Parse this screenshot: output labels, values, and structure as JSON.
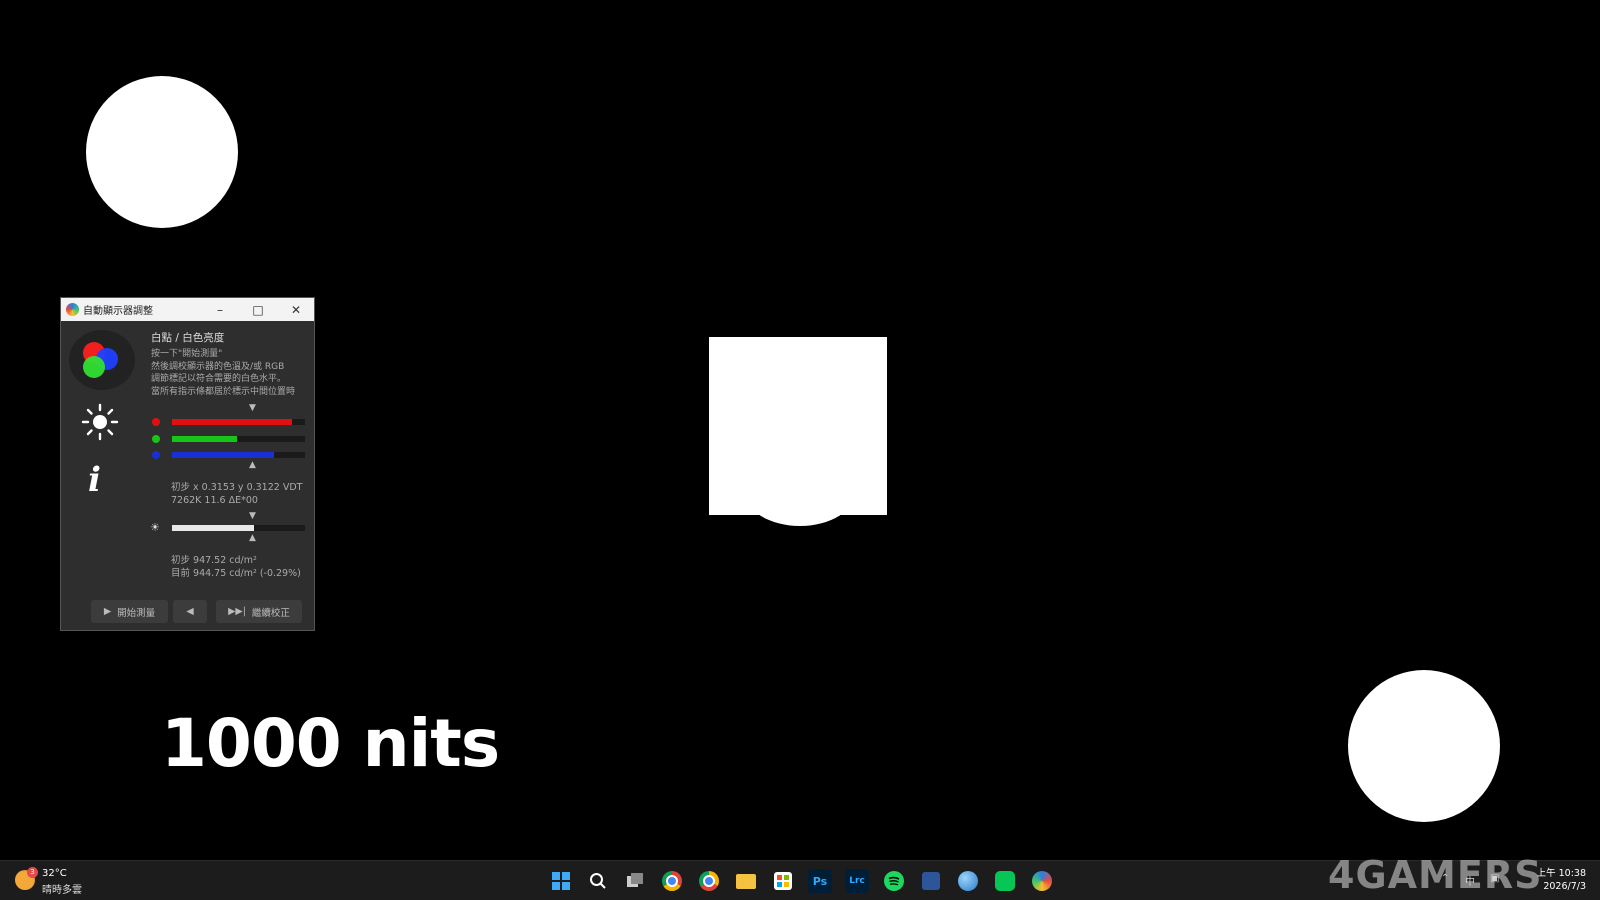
{
  "window": {
    "title": "自動顯示器調整",
    "heading": "白點 / 白色亮度",
    "description": [
      "按一下\"開始測量\"",
      "然後調校顯示器的色溫及/或 RGB",
      "調節標記以符合需要的白色水平。",
      "當所有指示條都居於標示中間位置時"
    ],
    "white_point_readout": [
      "初步 x 0.3153 y 0.3122 VDT",
      "7262K 11.6 ΔE*00"
    ],
    "luminance_readout": [
      "初步 947.52 cd/m²",
      "目前 944.75 cd/m² (-0.29%)"
    ],
    "rgb_levels": {
      "red": 0.9,
      "green": 0.49,
      "blue": 0.77
    },
    "luminance_level": 0.62,
    "buttons": {
      "start": "開始測量",
      "back": "◀",
      "continue": "繼續校正"
    }
  },
  "overlay_text": "1000 nits",
  "taskbar": {
    "weather_badge": "3",
    "temperature": "32°C",
    "condition": "晴時多雲",
    "apps": [
      "windows-start",
      "search",
      "task-view",
      "chrome",
      "chrome-canary",
      "file-explorer",
      "microsoft-store",
      "photoshop",
      "lightroom-classic",
      "spotify",
      "word",
      "web-browser",
      "line",
      "displaycal"
    ],
    "photoshop_label": "Ps",
    "lightroom_label": "Lrc",
    "clock_time": "上午 10:38",
    "clock_date": "2026/7/3",
    "tray_ime": "中"
  },
  "watermark": "4GAMERS",
  "colors": {
    "red": "#e01010",
    "green": "#19c419",
    "blue": "#1a2fd6",
    "background": "#000000",
    "window": "#2e2e2e"
  }
}
